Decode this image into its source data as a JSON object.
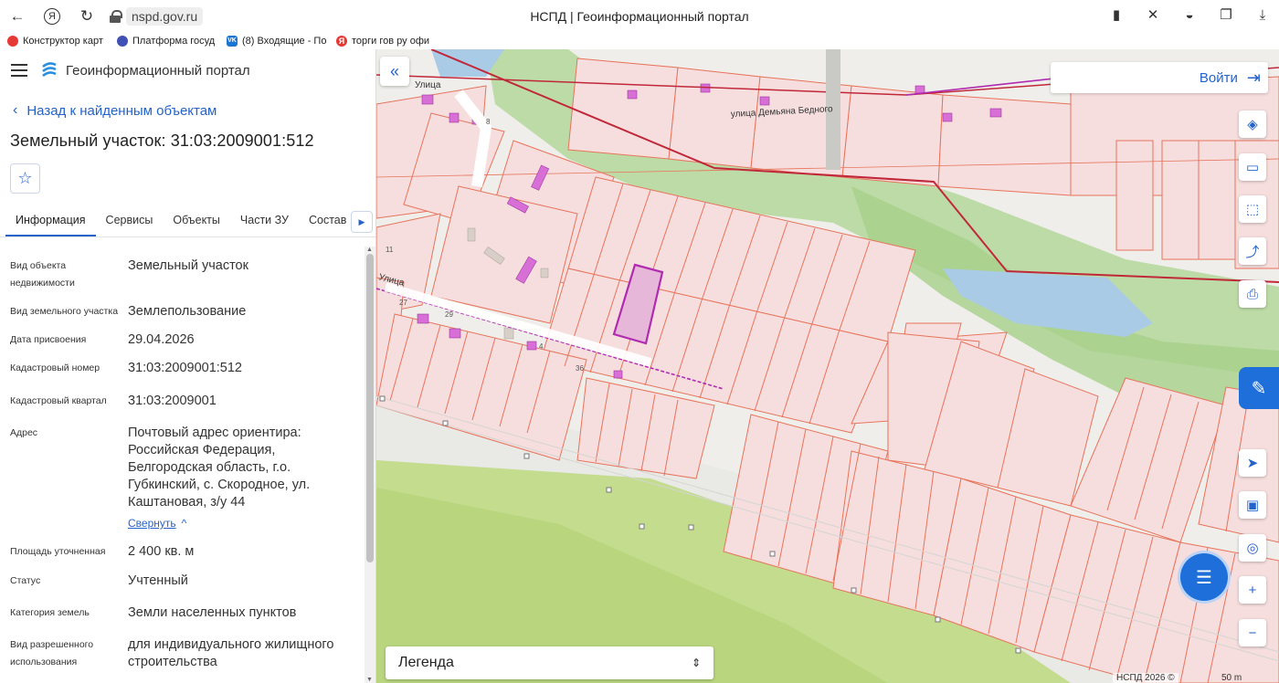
{
  "browser": {
    "url": "nspd.gov.ru",
    "title": "НСПД | Геоинформационный портал",
    "bookmarks": [
      {
        "label": "Конструктор карт",
        "color": "#e53935",
        "glyph": "●"
      },
      {
        "label": "Платформа госуд",
        "color": "#3f51b5",
        "glyph": "●"
      },
      {
        "label": "(8) Входящие - По",
        "color": "#1976d2",
        "glyph": "VK"
      },
      {
        "label": "торги гов ру офи",
        "color": "#e53935",
        "glyph": "Я"
      }
    ]
  },
  "panel": {
    "portal_name": "Геоинформационный портал",
    "back_label": "Назад к найденным объектам",
    "title": "Земельный участок: 31:03:2009001:512",
    "tabs": [
      "Информация",
      "Сервисы",
      "Объекты",
      "Части ЗУ",
      "Состав"
    ],
    "properties": [
      {
        "label": "Вид объекта недвижимости",
        "value": "Земельный участок"
      },
      {
        "label": "Вид земельного участка",
        "value": "Землепользование"
      },
      {
        "label": "Дата присвоения",
        "value": "29.04.2026"
      },
      {
        "label": "Кадастровый номер",
        "value": "31:03:2009001:512"
      },
      {
        "label": "Кадастровый квартал",
        "value": "31:03:2009001"
      },
      {
        "label": "Адрес",
        "value": "Почтовый адрес ориентира: Российская Федерация, Белгородская область, г.о. Губкинский, с. Скородное, ул. Каштановая, з/у 44"
      },
      {
        "label": "Площадь уточненная",
        "value": "2 400 кв. м"
      },
      {
        "label": "Статус",
        "value": "Учтенный"
      },
      {
        "label": "Категория земель",
        "value": "Земли населенных пунктов"
      },
      {
        "label": "Вид разрешенного использования",
        "value": "для индивидуального жилищного строительства"
      }
    ],
    "collapse_label": "Свернуть"
  },
  "map": {
    "login_label": "Войти",
    "legend_label": "Легенда",
    "copyright": "НСПД 2026 ©",
    "scale": "50 m",
    "streets": [
      "Улица",
      "улица Демьяна Бедного",
      "Улица"
    ],
    "plot_numbers": [
      "27",
      "29",
      "4",
      "36",
      "11",
      "8"
    ],
    "colors": {
      "parcel_stroke": "#e8735a",
      "parcel_fill": "#f6dede",
      "selected": "#b02bb0",
      "green": "#aed489",
      "water": "#a9cbe6",
      "border": "#c0283a"
    }
  }
}
